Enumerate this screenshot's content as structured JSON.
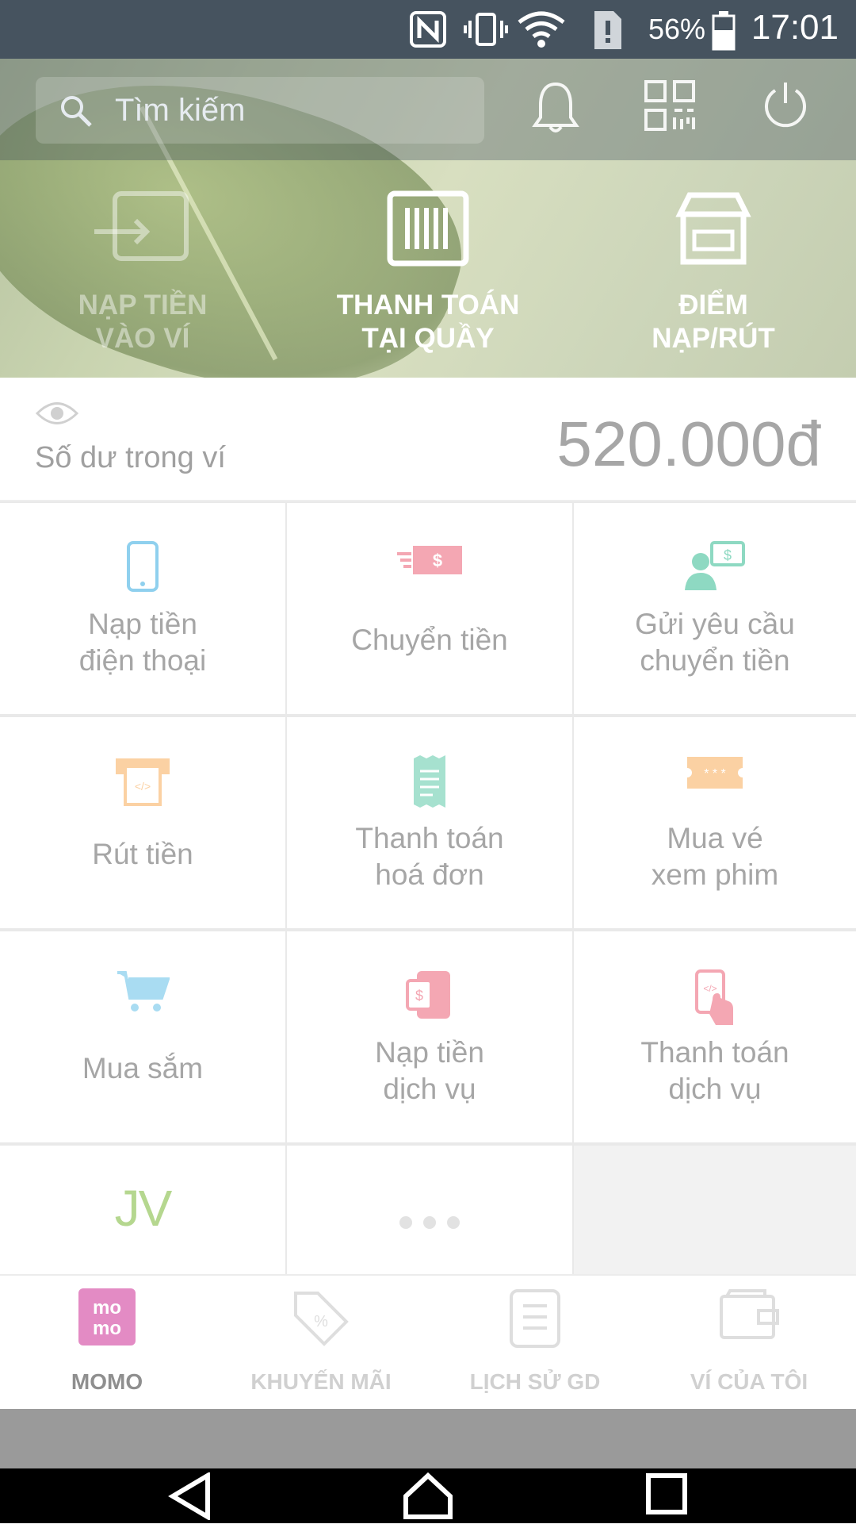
{
  "status_bar": {
    "battery_percent": "56%",
    "time": "17:01"
  },
  "top_bar": {
    "search_placeholder": "Tìm kiếm"
  },
  "quick_actions": [
    {
      "label": "NẠP TIỀN VÀO VÍ",
      "icon": "wallet-in-icon"
    },
    {
      "label": "THANH TOÁN TẠI QUẦY",
      "icon": "barcode-icon"
    },
    {
      "label": "ĐIỂM NẠP/RÚT",
      "icon": "store-icon"
    }
  ],
  "balance": {
    "label": "Số dư trong ví",
    "amount": "520.000đ"
  },
  "services": [
    {
      "line1": "Nạp tiền",
      "line2": "điện thoại",
      "icon": "phone-icon",
      "color": "#6ec3e8"
    },
    {
      "line1": "Chuyển tiền",
      "line2": "",
      "icon": "money-transfer-icon",
      "color": "#f08a9a"
    },
    {
      "line1": "Gửi yêu cầu",
      "line2": "chuyển tiền",
      "icon": "request-money-icon",
      "color": "#5cc9a7"
    },
    {
      "line1": "Rút tiền",
      "line2": "",
      "icon": "atm-withdraw-icon",
      "color": "#f7b56a"
    },
    {
      "line1": "Thanh toán",
      "line2": "hoá đơn",
      "icon": "bill-icon",
      "color": "#5cc9a7"
    },
    {
      "line1": "Mua vé",
      "line2": "xem phim",
      "icon": "ticket-icon",
      "color": "#f7b56a"
    },
    {
      "line1": "Mua sắm",
      "line2": "",
      "icon": "cart-icon",
      "color": "#6ec3e8"
    },
    {
      "line1": "Nạp tiền",
      "line2": "dịch vụ",
      "icon": "service-topup-icon",
      "color": "#f08a9a"
    },
    {
      "line1": "Thanh toán",
      "line2": "dịch vụ",
      "icon": "service-pay-icon",
      "color": "#f08a9a"
    }
  ],
  "extra": {
    "jv_logo": "JV"
  },
  "bottom_nav": [
    {
      "label": "MOMO",
      "icon": "momo-logo-icon",
      "active": true
    },
    {
      "label": "KHUYẾN MÃI",
      "icon": "promo-tag-icon"
    },
    {
      "label": "LỊCH SỬ GD",
      "icon": "history-icon"
    },
    {
      "label": "VÍ CỦA TÔI",
      "icon": "wallet-icon"
    }
  ],
  "momo_logo_text": "mo mo",
  "colors": {
    "brand": "#d6409f",
    "status_bar": "#46535f"
  }
}
